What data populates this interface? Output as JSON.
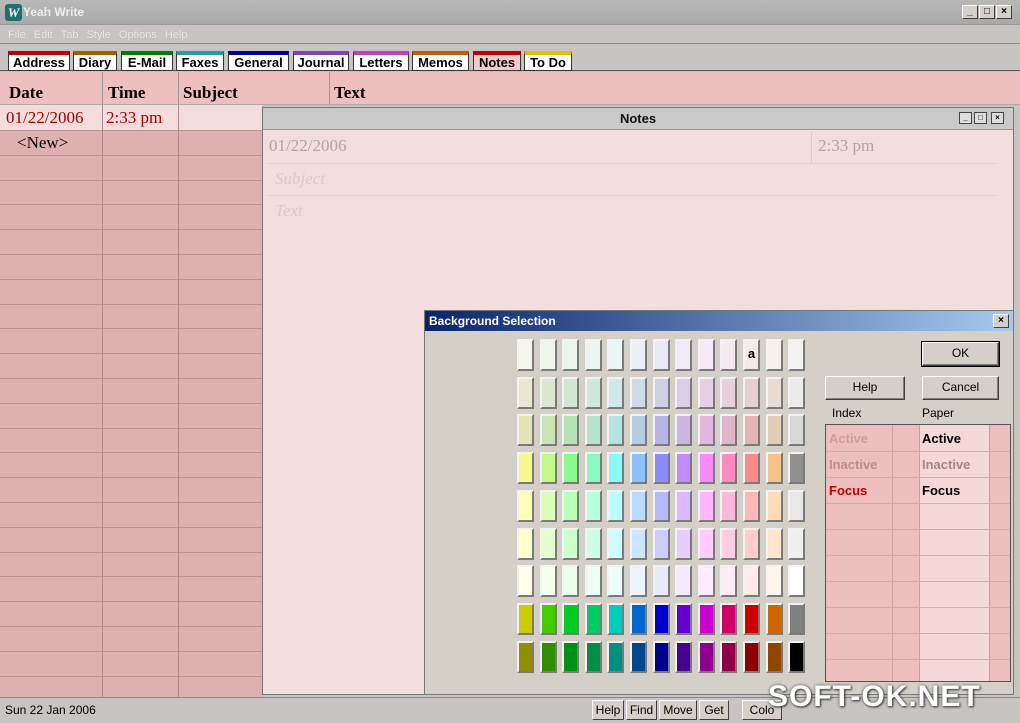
{
  "app": {
    "title": "Yeah Write"
  },
  "menu": [
    "File",
    "Edit",
    "Tab",
    "Style",
    "Options",
    "Help"
  ],
  "tabs": [
    {
      "label": "Address",
      "color": "#c00000"
    },
    {
      "label": "Diary",
      "color": "#a06000"
    },
    {
      "label": "E-Mail",
      "color": "#008000"
    },
    {
      "label": "Faxes",
      "color": "#20a0a0"
    },
    {
      "label": "General",
      "color": "#0000a0"
    },
    {
      "label": "Journal",
      "color": "#8040c0"
    },
    {
      "label": "Letters",
      "color": "#c040c0"
    },
    {
      "label": "Memos",
      "color": "#c06000"
    },
    {
      "label": "Notes",
      "color": "#c00000"
    },
    {
      "label": "To Do",
      "color": "#e0c000"
    }
  ],
  "list": {
    "headers": [
      "Date",
      "Time",
      "Subject",
      "Text"
    ],
    "rows": [
      {
        "date": "01/22/2006",
        "time": "2:33 pm"
      },
      {
        "date": "<New>",
        "time": ""
      }
    ]
  },
  "notes_window": {
    "title": "Notes",
    "date": "01/22/2006",
    "time": "2:33 pm",
    "subject_placeholder": "Subject",
    "text_placeholder": "Text"
  },
  "dialog": {
    "title": "Background Selection",
    "ok": "OK",
    "help": "Help",
    "cancel": "Cancel",
    "index_label": "Index",
    "paper_label": "Paper",
    "swatch_letter": "a",
    "index_items": [
      {
        "label": "Active",
        "color": "#c7a0a0"
      },
      {
        "label": "Inactive",
        "color": "#b49090"
      },
      {
        "label": "Focus",
        "color": "#c00000"
      }
    ],
    "paper_items": [
      {
        "label": "Active",
        "color": "#000000"
      },
      {
        "label": "Inactive",
        "color": "#a08888"
      },
      {
        "label": "Focus",
        "color": "#000000"
      }
    ]
  },
  "statusbar": {
    "date": "Sun 22 Jan 2006",
    "buttons": [
      "Help",
      "Find",
      "Move",
      "Get",
      "Colo"
    ]
  },
  "watermark": "SOFT-OK.NET",
  "colors": {
    "accent_red": "#a00000",
    "list_bg": "#dfb0b0"
  }
}
